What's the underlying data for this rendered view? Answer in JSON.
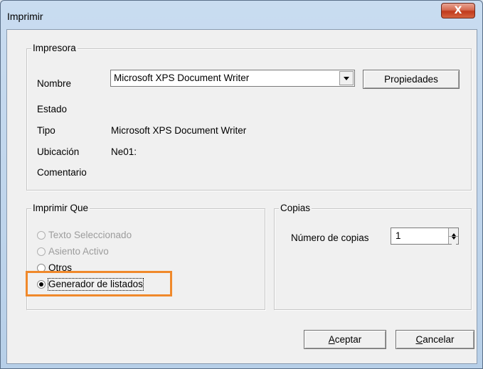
{
  "window": {
    "title": "Imprimir",
    "close_label": "X"
  },
  "printer": {
    "group_label": "Impresora",
    "name_label": "Nombre",
    "name_value": "Microsoft XPS Document Writer",
    "properties_label": "Propiedades",
    "status_label": "Estado",
    "status_value": "",
    "type_label": "Tipo",
    "type_value": "Microsoft XPS Document Writer",
    "location_label": "Ubicación",
    "location_value": "Ne01:",
    "comment_label": "Comentario",
    "comment_value": ""
  },
  "print_what": {
    "group_label": "Imprimir Que",
    "options": [
      {
        "label": "Texto Seleccionado",
        "enabled": false,
        "selected": false
      },
      {
        "label": "Asiento Activo",
        "enabled": false,
        "selected": false
      },
      {
        "label": "Otros",
        "enabled": true,
        "selected": false
      },
      {
        "label": "Generador de listados",
        "enabled": true,
        "selected": true
      }
    ]
  },
  "copies": {
    "group_label": "Copias",
    "count_label": "Número de copias",
    "count_value": "1"
  },
  "buttons": {
    "accept_accel": "A",
    "accept_rest": "ceptar",
    "cancel_accel": "C",
    "cancel_rest": "ancelar"
  },
  "colors": {
    "highlight": "#f0892b",
    "close_button": "#c0391b",
    "dialog_background": "#f0f0f0"
  }
}
